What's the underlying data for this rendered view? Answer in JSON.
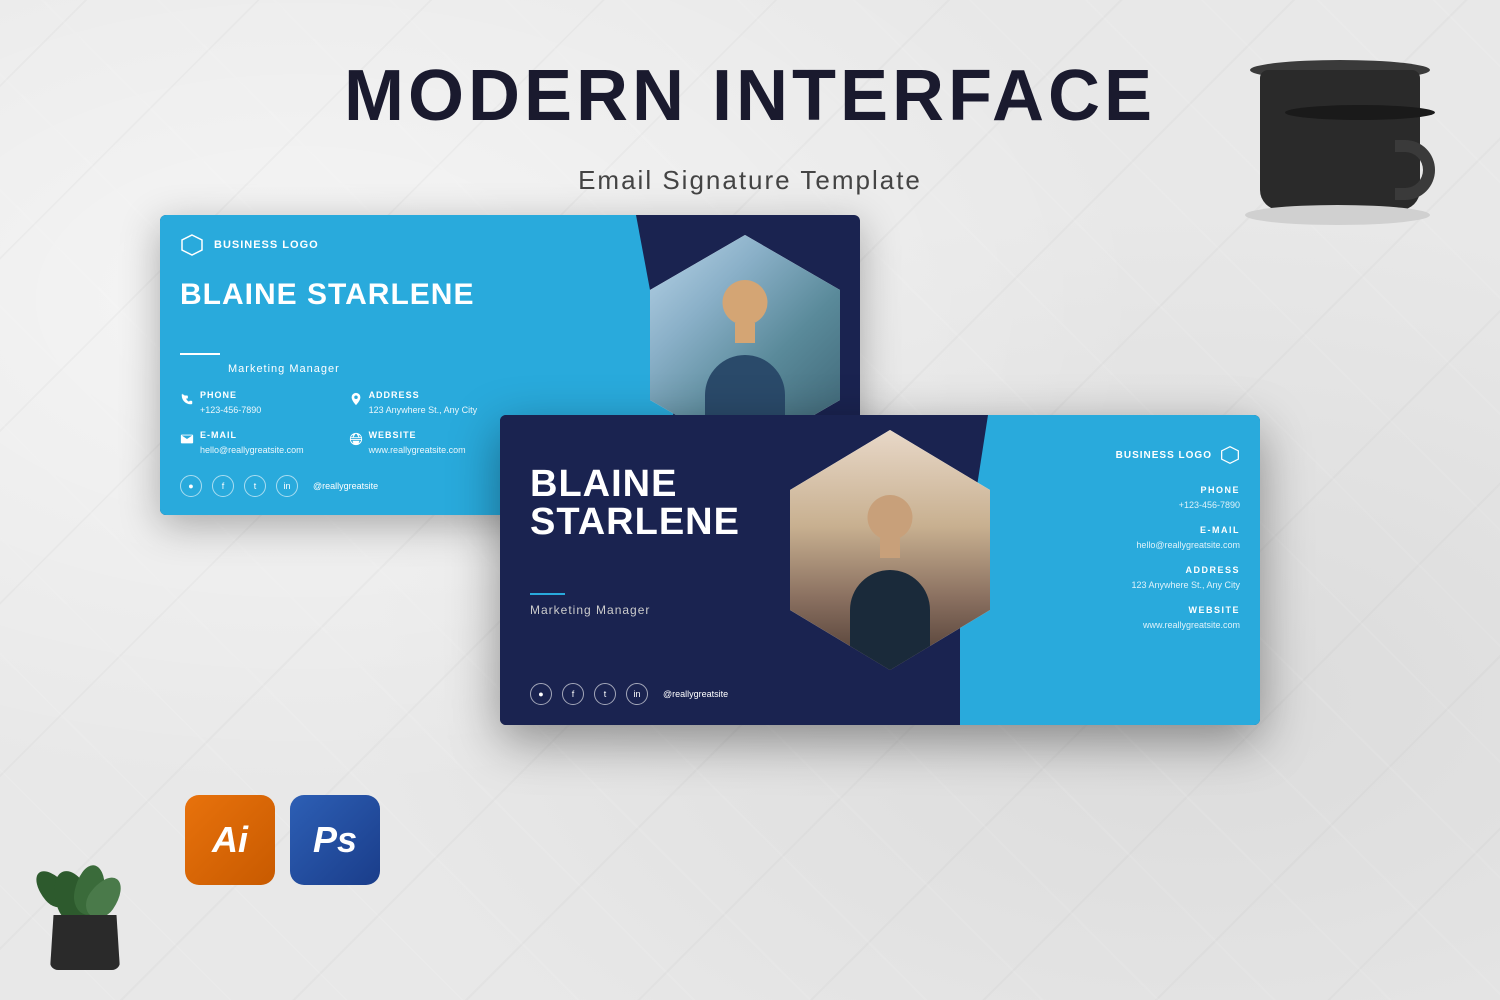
{
  "page": {
    "title": "MODERN INTERFACE",
    "subtitle": "Email Signature Template",
    "background_color": "#e8e8e8"
  },
  "card1": {
    "business_logo": "BUSINESS LOGO",
    "name": "BLAINE STARLENE",
    "job_title": "Marketing Manager",
    "phone_label": "PHONE",
    "phone_value": "+123-456-7890",
    "email_label": "E-MAIL",
    "email_value": "hello@reallygreatsite.com",
    "address_label": "ADDRESS",
    "address_value": "123 Anywhere St., Any City",
    "website_label": "WEBSITE",
    "website_value": "www.reallygreatsite.com",
    "social_handle": "@reallygreatsite"
  },
  "card2": {
    "business_logo": "BUSINESS LOGO",
    "name_line1": "BLAINE",
    "name_line2": "STARLENE",
    "job_title": "Marketing Manager",
    "phone_label": "PHONE",
    "phone_value": "+123-456-7890",
    "email_label": "E-MAIL",
    "email_value": "hello@reallygreatsite.com",
    "address_label": "ADDRESS",
    "address_value": "123 Anywhere St., Any City",
    "website_label": "WEBSITE",
    "website_value": "www.reallygreatsite.com",
    "social_handle": "@reallygreatsite"
  },
  "software": {
    "ai_label": "Ai",
    "ps_label": "Ps"
  },
  "colors": {
    "dark_navy": "#1a2350",
    "bright_blue": "#29aadc",
    "ai_orange": "#e8720c",
    "ps_blue": "#2d5fb5"
  }
}
